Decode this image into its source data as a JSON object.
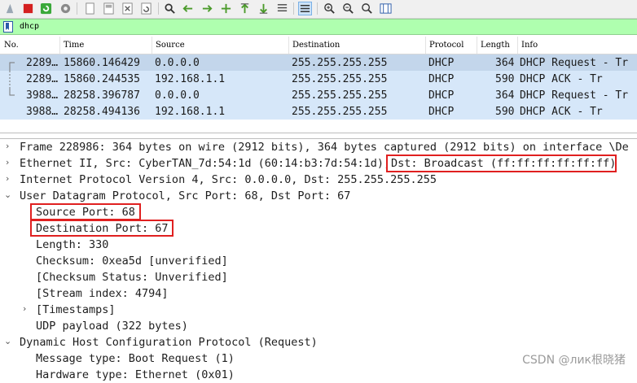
{
  "filter": {
    "value": "dhcp"
  },
  "packet_list": {
    "columns": [
      "No.",
      "Time",
      "Source",
      "Destination",
      "Protocol",
      "Length",
      "Info"
    ],
    "rows": [
      {
        "no": "2289…",
        "time": "15860.146429",
        "source": "0.0.0.0",
        "destination": "255.255.255.255",
        "protocol": "DHCP",
        "length": "364",
        "info": "DHCP Request  - Tr",
        "selected": true
      },
      {
        "no": "2289…",
        "time": "15860.244535",
        "source": "192.168.1.1",
        "destination": "255.255.255.255",
        "protocol": "DHCP",
        "length": "590",
        "info": "DHCP ACK      - Tr",
        "selected": false
      },
      {
        "no": "3988…",
        "time": "28258.396787",
        "source": "0.0.0.0",
        "destination": "255.255.255.255",
        "protocol": "DHCP",
        "length": "364",
        "info": "DHCP Request  - Tr",
        "selected": false
      },
      {
        "no": "3988…",
        "time": "28258.494136",
        "source": "192.168.1.1",
        "destination": "255.255.255.255",
        "protocol": "DHCP",
        "length": "590",
        "info": "DHCP ACK      - Tr",
        "selected": false
      }
    ]
  },
  "details": {
    "frame": "Frame 228986: 364 bytes on wire (2912 bits), 364 bytes captured (2912 bits) on interface \\De",
    "ethernet_prefix": "Ethernet II, Src: CyberTAN_7d:54:1d (60:14:b3:7d:54:1d),",
    "ethernet_dst": "Dst: Broadcast (ff:ff:ff:ff:ff:ff)",
    "ip": "Internet Protocol Version 4, Src: 0.0.0.0, Dst: 255.255.255.255",
    "udp": "User Datagram Protocol, Src Port: 68, Dst Port: 67",
    "src_port": "Source Port: 68",
    "dst_port": "Destination Port: 67",
    "length": "Length: 330",
    "checksum": "Checksum: 0xea5d [unverified]",
    "checksum_status": "[Checksum Status: Unverified]",
    "stream_index": "[Stream index: 4794]",
    "timestamps": "[Timestamps]",
    "udp_payload": "UDP payload (322 bytes)",
    "dhcp": "Dynamic Host Configuration Protocol (Request)",
    "message_type": "Message type: Boot Request (1)",
    "hardware_type": "Hardware type: Ethernet (0x01)"
  },
  "watermark": "CSDN @лик根晓猪",
  "colors": {
    "filter_bg": "#afffaf",
    "row_bg": "#d6e7f9",
    "selected_row_bg": "#c3d6eb",
    "highlight": "#e02020"
  },
  "icons": [
    "shark-fin-icon",
    "stop-capture-icon",
    "restart-capture-icon",
    "capture-options-icon",
    "open-file-icon",
    "save-file-icon",
    "close-file-icon",
    "reload-file-icon",
    "find-packet-icon",
    "go-back-icon",
    "go-forward-icon",
    "go-to-packet-icon",
    "go-first-icon",
    "go-last-icon",
    "autoscroll-icon",
    "colorize-icon",
    "zoom-in-icon",
    "zoom-out-icon",
    "normal-size-icon",
    "resize-columns-icon"
  ]
}
